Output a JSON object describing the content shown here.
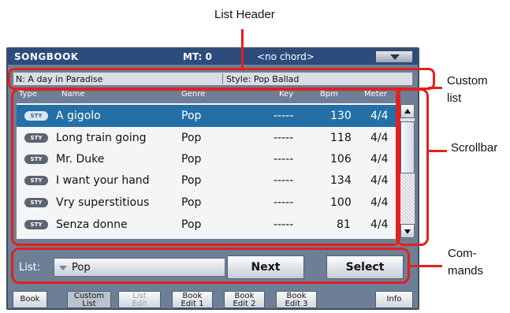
{
  "annotations": {
    "list_header": "List Header",
    "custom_list": "Custom\nlist",
    "scrollbar": "Scrollbar",
    "commands": "Com-\nmands"
  },
  "topbar": {
    "title": "SONGBOOK",
    "mt": "MT: 0",
    "chord": "<no chord>",
    "menu_icon": "triangle-down"
  },
  "infobar": {
    "name": "N: A day in Paradise",
    "style": "Style: Pop Ballad"
  },
  "columns": [
    "Type",
    "Name",
    "Genre",
    "Key",
    "Bpm",
    "Meter"
  ],
  "rows": [
    {
      "type": "STY",
      "name": "A gigolo",
      "genre": "Pop",
      "key": "-----",
      "bpm": "130",
      "meter": "4/4"
    },
    {
      "type": "STY",
      "name": "Long train going",
      "genre": "Pop",
      "key": "-----",
      "bpm": "118",
      "meter": "4/4"
    },
    {
      "type": "STY",
      "name": "Mr. Duke",
      "genre": "Pop",
      "key": "-----",
      "bpm": "106",
      "meter": "4/4"
    },
    {
      "type": "STY",
      "name": "I want your hand",
      "genre": "Pop",
      "key": "-----",
      "bpm": "134",
      "meter": "4/4"
    },
    {
      "type": "STY",
      "name": "Vry superstitious",
      "genre": "Pop",
      "key": "-----",
      "bpm": "100",
      "meter": "4/4"
    },
    {
      "type": "STY",
      "name": "Senza donne",
      "genre": "Pop",
      "key": "-----",
      "bpm": "81",
      "meter": "4/4"
    }
  ],
  "commands": {
    "list_label": "List:",
    "list_value": "Pop",
    "next": "Next",
    "select": "Select"
  },
  "tabs": [
    {
      "line1": "Book",
      "line2": ""
    },
    {
      "line1": "Custom",
      "line2": "List"
    },
    {
      "line1": "List",
      "line2": "Edit"
    },
    {
      "line1": "Book",
      "line2": "Edit 1"
    },
    {
      "line1": "Book",
      "line2": "Edit 2"
    },
    {
      "line1": "Book",
      "line2": "Edit 3"
    },
    {
      "line1": "Info",
      "line2": ""
    }
  ],
  "colors": {
    "annotation": "#e2211c",
    "selected_row": "#2470a6",
    "topbar": "#2b4c7d",
    "screen_bg": "#6d7f96"
  }
}
